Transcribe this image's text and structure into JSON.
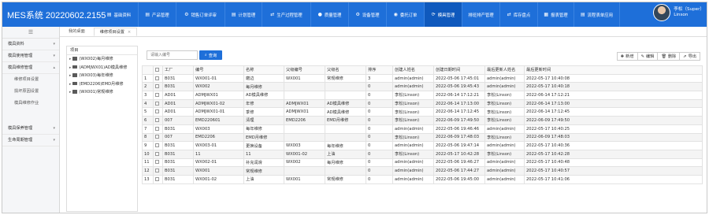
{
  "app": {
    "title": "MES系统 20220602.2155"
  },
  "nav": [
    {
      "icon": "doc-icon",
      "glyph": "▤",
      "label": "基础资料",
      "w": 49
    },
    {
      "icon": "doc-icon",
      "glyph": "▤",
      "label": "产品管理",
      "w": 48
    },
    {
      "icon": "settings-icon",
      "glyph": "⚙",
      "label": "销售订单评审",
      "w": 62
    },
    {
      "icon": "doc-icon",
      "glyph": "▤",
      "label": "计划管理",
      "w": 47
    },
    {
      "icon": "exchange-icon",
      "glyph": "⇄",
      "label": "生产过程管理",
      "w": 62
    },
    {
      "icon": "info-icon",
      "glyph": "●",
      "label": "质量管理",
      "w": 48
    },
    {
      "icon": "settings-icon",
      "glyph": "⚙",
      "label": "设备管理",
      "w": 48
    },
    {
      "icon": "check-icon",
      "glyph": "◉",
      "label": "委托订单",
      "w": 48
    },
    {
      "icon": "wrench-icon",
      "glyph": "⟳",
      "label": "模具管理",
      "w": 48,
      "active": true
    },
    {
      "icon": "",
      "glyph": "",
      "label": "排班排产管理",
      "w": 48
    },
    {
      "icon": "exchange-icon",
      "glyph": "⇄",
      "label": "库存盘点",
      "w": 48
    },
    {
      "icon": "chart-icon",
      "glyph": "▦",
      "label": "报表管理",
      "w": 46
    },
    {
      "icon": "doc-icon",
      "glyph": "▤",
      "label": "流程表单应用",
      "w": 58
    }
  ],
  "user": {
    "name": "李松（Super）",
    "login": "Linson"
  },
  "sidebar": {
    "items": [
      {
        "label": "模具资料",
        "chevron": "▾"
      },
      {
        "label": "模具使用管理",
        "chevron": "▾"
      },
      {
        "label": "模具维修管理",
        "chevron": "▴"
      }
    ],
    "subitems": [
      "维修项目设置",
      "损坏原因设置",
      "模具维修作业"
    ],
    "items2": [
      {
        "label": "模具保养管理",
        "chevron": "▾"
      },
      {
        "label": "生命周期管理",
        "chevron": "▾"
      }
    ]
  },
  "tabs": [
    {
      "label": "我的桌面",
      "closable": false
    },
    {
      "label": "维修项目设置",
      "closable": true
    }
  ],
  "tree": {
    "header": "项目",
    "nodes": [
      "(WX002)每月维修",
      "(ADMJWX01)AD模具维修",
      "(WX003)每年维修",
      "(EMD2206)EMD月维修",
      "(WX001)常规维修"
    ]
  },
  "search": {
    "placeholder": "请输入编号",
    "button": "查询"
  },
  "toolbar": [
    {
      "icon": "plus-icon",
      "glyph": "✚",
      "label": "新增"
    },
    {
      "icon": "edit-icon",
      "glyph": "✎",
      "label": "编辑"
    },
    {
      "icon": "delete-icon",
      "glyph": "🗑",
      "label": "删除"
    },
    {
      "icon": "export-icon",
      "glyph": "⇗",
      "label": "导出"
    }
  ],
  "table": {
    "columns": [
      "",
      "",
      "工厂",
      "编号",
      "名称",
      "父级编号",
      "父级名",
      "排序",
      "创建人姓名",
      "创建日期时间",
      "最后更新人姓名",
      "最后更新时间"
    ],
    "rows": [
      [
        "1",
        "B031",
        "WX001-01",
        "磨边",
        "WX001",
        "常规维修",
        "3",
        "admin(admin)",
        "2022-05-06 17:45:01",
        "admin(admin)",
        "2022-05-17 10:40:08"
      ],
      [
        "2",
        "B031",
        "WX002",
        "每月维修",
        "",
        "",
        "0",
        "admin(admin)",
        "2022-05-06 19:45:43",
        "admin(admin)",
        "2022-05-17 10:40:18"
      ],
      [
        "3",
        "AD01",
        "ADMJWX01",
        "AD模具维修",
        "",
        "",
        "0",
        "李松(Linson)",
        "2022-06-14 17:12:21",
        "李松(Linson)",
        "2022-06-14 17:12:21"
      ],
      [
        "4",
        "AD01",
        "ADMJWX01-02",
        "年修",
        "ADMJWX01",
        "AD模具维修",
        "0",
        "李松(Linson)",
        "2022-06-14 17:13:00",
        "李松(Linson)",
        "2022-06-14 17:13:00"
      ],
      [
        "5",
        "AD01",
        "ADMJWX01-01",
        "季修",
        "ADMJWX01",
        "AD模具维修",
        "0",
        "李松(Linson)",
        "2022-06-14 17:12:45",
        "李松(Linson)",
        "2022-06-14 17:12:45"
      ],
      [
        "6",
        "007",
        "EMD220601",
        "清理",
        "EMD2206",
        "EMD月维修",
        "0",
        "李松(Linson)",
        "2022-06-09 17:49:50",
        "李松(Linson)",
        "2022-06-09 17:49:50"
      ],
      [
        "7",
        "B031",
        "WX003",
        "每年维修",
        "",
        "",
        "0",
        "admin(admin)",
        "2022-05-06 19:46:46",
        "admin(admin)",
        "2022-05-17 10:40:25"
      ],
      [
        "8",
        "007",
        "EMD2206",
        "EMD月维修",
        "",
        "",
        "0",
        "李松(Linson)",
        "2022-06-09 17:48:03",
        "李松(Linson)",
        "2022-06-09 17:48:03"
      ],
      [
        "9",
        "B031",
        "WX003-01",
        "更换设备",
        "WX003",
        "每年维修",
        "0",
        "admin(admin)",
        "2022-05-06 19:47:14",
        "admin(admin)",
        "2022-05-17 10:40:36"
      ],
      [
        "10",
        "B031",
        "11",
        "11",
        "WX001-02",
        "上油",
        "0",
        "李松(Linson)",
        "2022-05-17 10:42:28",
        "李松(Linson)",
        "2022-05-17 10:42:28"
      ],
      [
        "11",
        "B031",
        "WX002-01",
        "补充润滑",
        "WX002",
        "每月维修",
        "0",
        "admin(admin)",
        "2022-05-06 19:46:27",
        "admin(admin)",
        "2022-05-17 10:40:48"
      ],
      [
        "12",
        "B031",
        "WX001",
        "常规维修",
        "",
        "",
        "0",
        "admin(admin)",
        "2022-05-06 17:44:27",
        "admin(admin)",
        "2022-05-17 10:40:57"
      ],
      [
        "13",
        "B031",
        "WX001-02",
        "上油",
        "WX001",
        "常规维修",
        "0",
        "admin(admin)",
        "2022-05-06 19:45:00",
        "admin(admin)",
        "2022-05-17 10:41:06"
      ]
    ]
  }
}
